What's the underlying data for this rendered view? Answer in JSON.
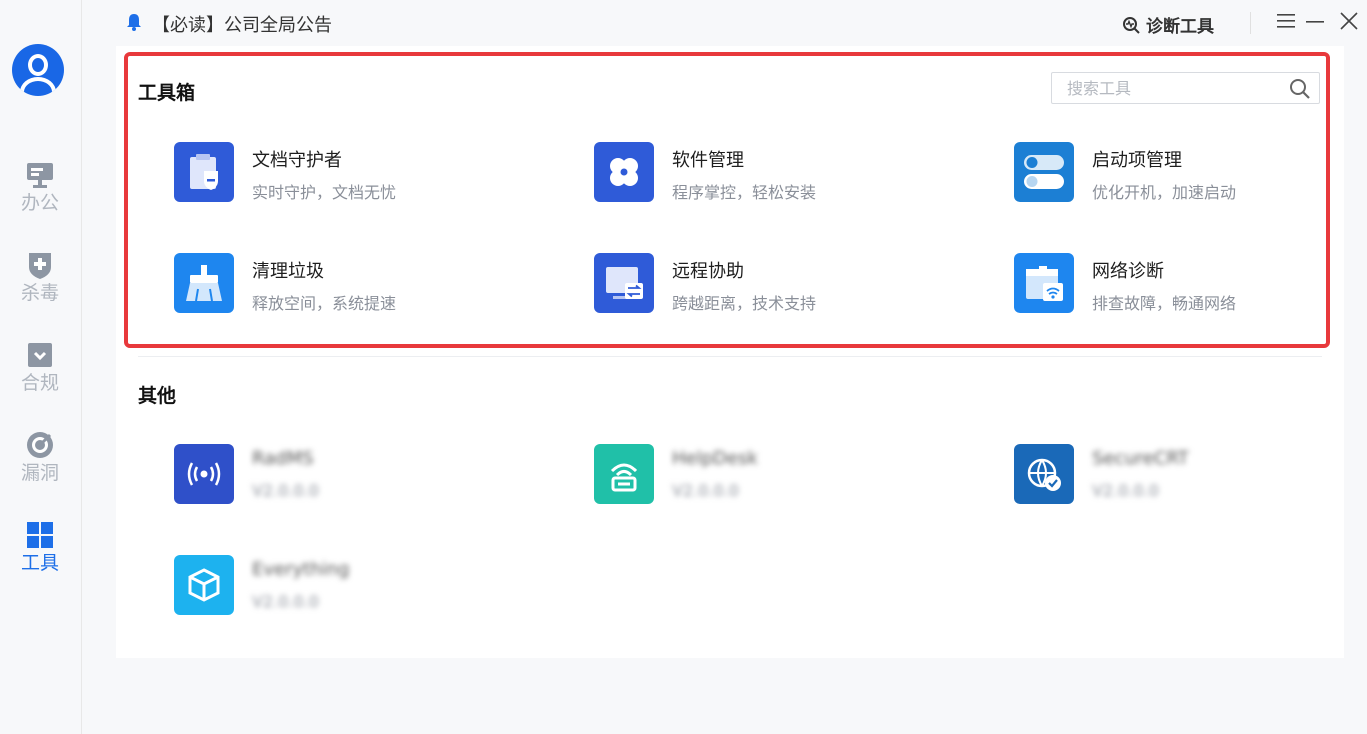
{
  "notice": {
    "text": "【必读】公司全局公告"
  },
  "header": {
    "diagnose_label": "诊断工具"
  },
  "sidebar": {
    "items": [
      {
        "label": "办公",
        "icon": "monitor-icon",
        "active": false
      },
      {
        "label": "杀毒",
        "icon": "shield-plus-icon",
        "active": false
      },
      {
        "label": "合规",
        "icon": "checkbox-icon",
        "active": false
      },
      {
        "label": "漏洞",
        "icon": "radar-icon",
        "active": false
      },
      {
        "label": "工具",
        "icon": "grid-icon",
        "active": true
      }
    ]
  },
  "toolbox": {
    "title": "工具箱",
    "search_placeholder": "搜索工具",
    "tools": [
      {
        "name": "文档守护者",
        "desc": "实时守护，文档无忧",
        "icon": "document-shield-icon",
        "color": "#2f5bd8"
      },
      {
        "name": "软件管理",
        "desc": "程序掌控，轻松安装",
        "icon": "clover-icon",
        "color": "#2f5bd8"
      },
      {
        "name": "启动项管理",
        "desc": "优化开机，加速启动",
        "icon": "toggle-icon",
        "color": "#1c7fd4"
      },
      {
        "name": "清理垃圾",
        "desc": "释放空间，系统提速",
        "icon": "broom-icon",
        "color": "#1e86ef"
      },
      {
        "name": "远程协助",
        "desc": "跨越距离，技术支持",
        "icon": "remote-screen-icon",
        "color": "#2f5bd8"
      },
      {
        "name": "网络诊断",
        "desc": "排查故障，畅通网络",
        "icon": "network-icon",
        "color": "#1e86ef"
      }
    ]
  },
  "others": {
    "title": "其他",
    "apps": [
      {
        "name": "RadMS",
        "version": "V2.0.0.0",
        "icon": "broadcast-icon",
        "color": "#2f50c9"
      },
      {
        "name": "HelpDesk",
        "version": "V2.0.0.0",
        "icon": "router-icon",
        "color": "#20c0a8"
      },
      {
        "name": "SecureCRT",
        "version": "V2.0.0.0",
        "icon": "globe-check-icon",
        "color": "#1a69b8"
      },
      {
        "name": "Everything",
        "version": "V2.0.0.0",
        "icon": "cube-icon",
        "color": "#1db2ef"
      }
    ]
  }
}
